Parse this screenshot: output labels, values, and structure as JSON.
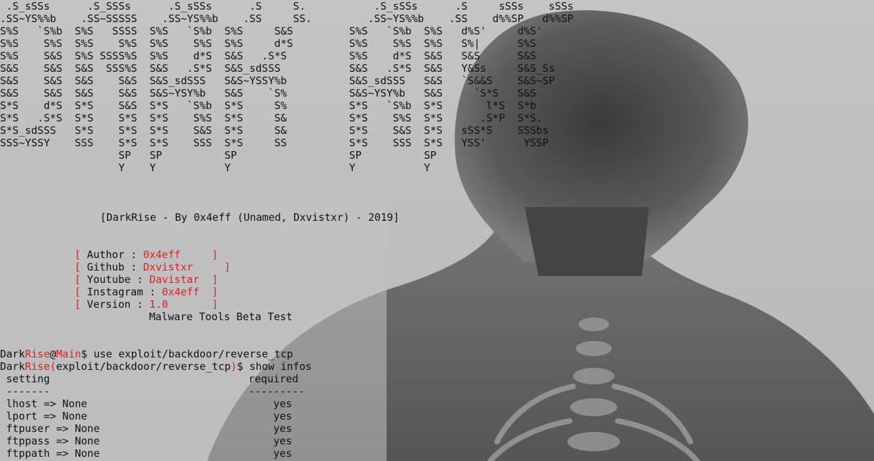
{
  "colors": {
    "accent_red": "#e02020",
    "text": "#111111",
    "background": "#bcbcbc"
  },
  "banner_lines": [
    " .S_sSSs      .S_SSSs      .S_sSSs      .S     S.           .S_sSSs      .S     sSSs    sSSs",
    ".SS~YS%%b    .SS~SSSSS    .SS~YS%%b    .SS     SS.         .SS~YS%%b    .SS    d%%SP   d%%SP",
    "S%S   `S%b  S%S   SSSS  S%S   `S%b  S%S     S&S         S%S   `S%b  S%S   d%S'     d%S'",
    "S%S    S%S  S%S    S%S  S%S    S%S  S%S     d*S         S%S    S%S  S%S   S%|      S%S",
    "S%S    S&S  S%S SSSS%S  S%S    d*S  S&S   .S*S          S%S    d*S  S&S   S&S      S&S",
    "S&S    S&S  S&S  SSS%S  S&S   .S*S  S&S_sdSSS           S&S   .S*S  S&S   Y&Ss     S&S_Ss",
    "S&S    S&S  S&S    S&S  S&S_sdSSS   S&S~YSSY%b          S&S_sdSSS   S&S   `S&&S    S&S~SP",
    "S&S    S&S  S&S    S&S  S&S~YSY%b   S&S    `S%          S&S~YSY%b   S&S     `S*S   S&S",
    "S*S    d*S  S*S    S&S  S*S   `S%b  S*S     S%          S*S   `S%b  S*S       l*S  S*b",
    "S*S   .S*S  S*S    S*S  S*S    S%S  S*S     S&          S*S    S%S  S*S      .S*P  S*S.",
    "S*S_sdSSS   S*S    S*S  S*S    S&S  S*S     S&          S*S    S&S  S*S   sSS*S    SSSbs",
    "SSS~YSSY    SSS    S*S  S*S    SSS  S*S     SS          S*S    SSS  S*S   YSS'      YSSP",
    "                   SP   SP          SP                  SP          SP",
    "                   Y    Y           Y                   Y           Y"
  ],
  "credit": "[DarkRise - By 0x4eff (Unamed, Dxvistxr) - 2019]",
  "info": [
    {
      "open": "[",
      "label": " Author : ",
      "value": "0x4eff",
      "close": "]"
    },
    {
      "open": "[",
      "label": " Github : ",
      "value": "Dxvistxr",
      "close": "]"
    },
    {
      "open": "[",
      "label": " Youtube : ",
      "value": "Davistar",
      "close": "]"
    },
    {
      "open": "[",
      "label": " Instagram : ",
      "value": "0x4eff",
      "close": "]"
    },
    {
      "open": "[",
      "label": " Version : ",
      "value": "1.0",
      "close": "]"
    }
  ],
  "tagline": "Malware Tools Beta Test",
  "prompt1": {
    "user": "Dark",
    "user_red": "Rise",
    "at": "@",
    "host": "Main",
    "suffix": "$ ",
    "command": "use exploit/backdoor/reverse_tcp"
  },
  "prompt2": {
    "user": "Dark",
    "user_red": "Rise(",
    "module": "exploit/backdoor/reverse_tcp",
    "close": ")",
    "suffix": "$ ",
    "command": "show infos"
  },
  "table": {
    "header_setting": " setting",
    "header_required": "required",
    "sep_setting": " -------",
    "sep_required": "---------",
    "rows": [
      {
        "setting": " lhost => None",
        "required": "yes"
      },
      {
        "setting": " lport => None",
        "required": "yes"
      },
      {
        "setting": " ftpuser => None",
        "required": "yes"
      },
      {
        "setting": " ftppass => None",
        "required": "yes"
      },
      {
        "setting": " ftppath => None",
        "required": "yes"
      }
    ]
  }
}
